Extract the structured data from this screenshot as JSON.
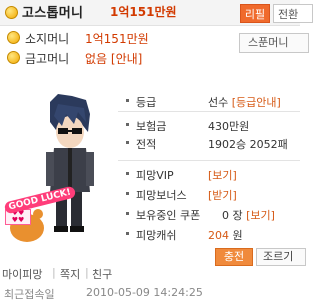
{
  "header": {
    "player_name": "고스톱머니",
    "player_money": "1억151만원",
    "replay_button": "리필",
    "transfer_button": "전환",
    "cash_label": "소지머니",
    "cash_value": "1억151만원",
    "vault_label": "금고머니",
    "vault_value": "없음 [안내]",
    "spoon_button": "스푼머니"
  },
  "avatar": {
    "good_luck": "GOOD LUCK!"
  },
  "subnav": {
    "item1": "마이피망",
    "item2": "쪽지",
    "item3": "친구"
  },
  "info": {
    "rank_label": "등급",
    "rank_value": "선수",
    "rank_link": "[등급안내]",
    "holdings_label": "보험금",
    "holdings_value": "430만원",
    "record_label": "전적",
    "record_value": "1902승 2052패",
    "vip_label": "피망VIP",
    "vip_link": "[보기]",
    "bonus_label": "피망보너스",
    "bonus_link": "[받기]",
    "coupon_label": "보유중인 쿠폰",
    "coupon_value": "0 장",
    "coupon_link": "[보기]",
    "cash_label": "피망캐쉬",
    "cash_value": "204",
    "cash_unit": "원",
    "charge_button": "충전",
    "view_button": "조르기"
  },
  "footer": {
    "last_login_label": "최근접속일",
    "last_login_value": "2010-05-09 14:24:25"
  },
  "colors": {
    "accent": "#f06a2c",
    "money": "#d23a00",
    "link": "#d65a16"
  }
}
